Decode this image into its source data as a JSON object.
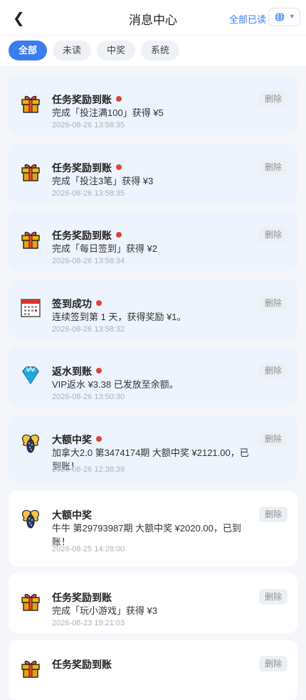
{
  "header": {
    "back_glyph": "❮",
    "title": "消息中心",
    "read_all": "全部已读",
    "lang_icon": "globe-icon",
    "lang_caret": "▼"
  },
  "tabs": [
    {
      "label": "全部",
      "active": true
    },
    {
      "label": "未读",
      "active": false
    },
    {
      "label": "中奖",
      "active": false
    },
    {
      "label": "系统",
      "active": false
    }
  ],
  "delete_label": "删除",
  "messages": [
    {
      "icon": "gift-icon",
      "title": "任务奖励到账",
      "unread": true,
      "body": "完成「投注满100」获得 ¥5",
      "time": "2026-08-26 13:58:35"
    },
    {
      "icon": "gift-icon",
      "title": "任务奖励到账",
      "unread": true,
      "body": "完成「投注3笔」获得 ¥3",
      "time": "2026-08-26 13:58:35"
    },
    {
      "icon": "gift-icon",
      "title": "任务奖励到账",
      "unread": true,
      "body": "完成「每日签到」获得 ¥2",
      "time": "2026-08-26 13:58:34"
    },
    {
      "icon": "calendar-icon",
      "title": "签到成功",
      "unread": true,
      "body": "连续签到第 1 天，获得奖励 ¥1。",
      "time": "2026-08-26 13:58:32"
    },
    {
      "icon": "diamond-icon",
      "title": "返水到账",
      "unread": true,
      "body": "VIP返水 ¥3.38 已发放至余额。",
      "time": "2026-08-26 13:50:30"
    },
    {
      "icon": "jackpot-icon",
      "title": "大额中奖",
      "unread": true,
      "body": "加拿大2.0 第3474174期 大额中奖 ¥2121.00，已到账！",
      "time": "2026-08-26 12:38:39"
    },
    {
      "icon": "jackpot-icon",
      "title": "大额中奖",
      "unread": false,
      "body": "牛牛 第29793987期 大额中奖 ¥2020.00，已到账！",
      "time": "2026-08-25 14:28:00"
    },
    {
      "icon": "gift-icon",
      "title": "任务奖励到账",
      "unread": false,
      "body": "完成「玩小游戏」获得 ¥3",
      "time": "2026-08-23 19:21:03"
    },
    {
      "icon": "gift-icon",
      "title": "任务奖励到账",
      "unread": false,
      "body": "",
      "time": ""
    }
  ]
}
